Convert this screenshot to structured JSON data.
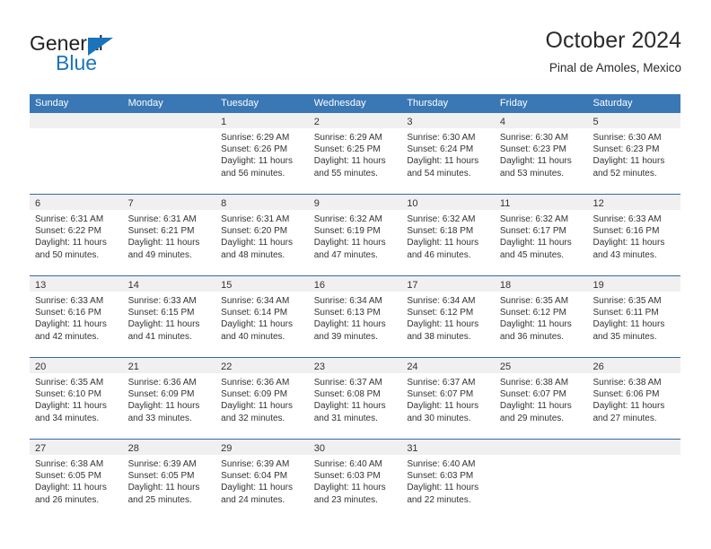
{
  "brand": {
    "word1": "General",
    "word2": "Blue",
    "triangle_color": "#1a74bb",
    "text_color": "#231f20"
  },
  "header": {
    "title": "October 2024",
    "subtitle": "Pinal de Amoles, Mexico",
    "accent_color": "#3a77b5"
  },
  "calendar": {
    "weekdays": [
      "Sunday",
      "Monday",
      "Tuesday",
      "Wednesday",
      "Thursday",
      "Friday",
      "Saturday"
    ],
    "labels": {
      "sunrise": "Sunrise:",
      "sunset": "Sunset:",
      "daylight": "Daylight:"
    },
    "weeks": [
      [
        {
          "day": "",
          "sunrise": "",
          "sunset": "",
          "daylight_1": "",
          "daylight_2": ""
        },
        {
          "day": "",
          "sunrise": "",
          "sunset": "",
          "daylight_1": "",
          "daylight_2": ""
        },
        {
          "day": "1",
          "sunrise": "Sunrise: 6:29 AM",
          "sunset": "Sunset: 6:26 PM",
          "daylight_1": "Daylight: 11 hours",
          "daylight_2": "and 56 minutes."
        },
        {
          "day": "2",
          "sunrise": "Sunrise: 6:29 AM",
          "sunset": "Sunset: 6:25 PM",
          "daylight_1": "Daylight: 11 hours",
          "daylight_2": "and 55 minutes."
        },
        {
          "day": "3",
          "sunrise": "Sunrise: 6:30 AM",
          "sunset": "Sunset: 6:24 PM",
          "daylight_1": "Daylight: 11 hours",
          "daylight_2": "and 54 minutes."
        },
        {
          "day": "4",
          "sunrise": "Sunrise: 6:30 AM",
          "sunset": "Sunset: 6:23 PM",
          "daylight_1": "Daylight: 11 hours",
          "daylight_2": "and 53 minutes."
        },
        {
          "day": "5",
          "sunrise": "Sunrise: 6:30 AM",
          "sunset": "Sunset: 6:23 PM",
          "daylight_1": "Daylight: 11 hours",
          "daylight_2": "and 52 minutes."
        }
      ],
      [
        {
          "day": "6",
          "sunrise": "Sunrise: 6:31 AM",
          "sunset": "Sunset: 6:22 PM",
          "daylight_1": "Daylight: 11 hours",
          "daylight_2": "and 50 minutes."
        },
        {
          "day": "7",
          "sunrise": "Sunrise: 6:31 AM",
          "sunset": "Sunset: 6:21 PM",
          "daylight_1": "Daylight: 11 hours",
          "daylight_2": "and 49 minutes."
        },
        {
          "day": "8",
          "sunrise": "Sunrise: 6:31 AM",
          "sunset": "Sunset: 6:20 PM",
          "daylight_1": "Daylight: 11 hours",
          "daylight_2": "and 48 minutes."
        },
        {
          "day": "9",
          "sunrise": "Sunrise: 6:32 AM",
          "sunset": "Sunset: 6:19 PM",
          "daylight_1": "Daylight: 11 hours",
          "daylight_2": "and 47 minutes."
        },
        {
          "day": "10",
          "sunrise": "Sunrise: 6:32 AM",
          "sunset": "Sunset: 6:18 PM",
          "daylight_1": "Daylight: 11 hours",
          "daylight_2": "and 46 minutes."
        },
        {
          "day": "11",
          "sunrise": "Sunrise: 6:32 AM",
          "sunset": "Sunset: 6:17 PM",
          "daylight_1": "Daylight: 11 hours",
          "daylight_2": "and 45 minutes."
        },
        {
          "day": "12",
          "sunrise": "Sunrise: 6:33 AM",
          "sunset": "Sunset: 6:16 PM",
          "daylight_1": "Daylight: 11 hours",
          "daylight_2": "and 43 minutes."
        }
      ],
      [
        {
          "day": "13",
          "sunrise": "Sunrise: 6:33 AM",
          "sunset": "Sunset: 6:16 PM",
          "daylight_1": "Daylight: 11 hours",
          "daylight_2": "and 42 minutes."
        },
        {
          "day": "14",
          "sunrise": "Sunrise: 6:33 AM",
          "sunset": "Sunset: 6:15 PM",
          "daylight_1": "Daylight: 11 hours",
          "daylight_2": "and 41 minutes."
        },
        {
          "day": "15",
          "sunrise": "Sunrise: 6:34 AM",
          "sunset": "Sunset: 6:14 PM",
          "daylight_1": "Daylight: 11 hours",
          "daylight_2": "and 40 minutes."
        },
        {
          "day": "16",
          "sunrise": "Sunrise: 6:34 AM",
          "sunset": "Sunset: 6:13 PM",
          "daylight_1": "Daylight: 11 hours",
          "daylight_2": "and 39 minutes."
        },
        {
          "day": "17",
          "sunrise": "Sunrise: 6:34 AM",
          "sunset": "Sunset: 6:12 PM",
          "daylight_1": "Daylight: 11 hours",
          "daylight_2": "and 38 minutes."
        },
        {
          "day": "18",
          "sunrise": "Sunrise: 6:35 AM",
          "sunset": "Sunset: 6:12 PM",
          "daylight_1": "Daylight: 11 hours",
          "daylight_2": "and 36 minutes."
        },
        {
          "day": "19",
          "sunrise": "Sunrise: 6:35 AM",
          "sunset": "Sunset: 6:11 PM",
          "daylight_1": "Daylight: 11 hours",
          "daylight_2": "and 35 minutes."
        }
      ],
      [
        {
          "day": "20",
          "sunrise": "Sunrise: 6:35 AM",
          "sunset": "Sunset: 6:10 PM",
          "daylight_1": "Daylight: 11 hours",
          "daylight_2": "and 34 minutes."
        },
        {
          "day": "21",
          "sunrise": "Sunrise: 6:36 AM",
          "sunset": "Sunset: 6:09 PM",
          "daylight_1": "Daylight: 11 hours",
          "daylight_2": "and 33 minutes."
        },
        {
          "day": "22",
          "sunrise": "Sunrise: 6:36 AM",
          "sunset": "Sunset: 6:09 PM",
          "daylight_1": "Daylight: 11 hours",
          "daylight_2": "and 32 minutes."
        },
        {
          "day": "23",
          "sunrise": "Sunrise: 6:37 AM",
          "sunset": "Sunset: 6:08 PM",
          "daylight_1": "Daylight: 11 hours",
          "daylight_2": "and 31 minutes."
        },
        {
          "day": "24",
          "sunrise": "Sunrise: 6:37 AM",
          "sunset": "Sunset: 6:07 PM",
          "daylight_1": "Daylight: 11 hours",
          "daylight_2": "and 30 minutes."
        },
        {
          "day": "25",
          "sunrise": "Sunrise: 6:38 AM",
          "sunset": "Sunset: 6:07 PM",
          "daylight_1": "Daylight: 11 hours",
          "daylight_2": "and 29 minutes."
        },
        {
          "day": "26",
          "sunrise": "Sunrise: 6:38 AM",
          "sunset": "Sunset: 6:06 PM",
          "daylight_1": "Daylight: 11 hours",
          "daylight_2": "and 27 minutes."
        }
      ],
      [
        {
          "day": "27",
          "sunrise": "Sunrise: 6:38 AM",
          "sunset": "Sunset: 6:05 PM",
          "daylight_1": "Daylight: 11 hours",
          "daylight_2": "and 26 minutes."
        },
        {
          "day": "28",
          "sunrise": "Sunrise: 6:39 AM",
          "sunset": "Sunset: 6:05 PM",
          "daylight_1": "Daylight: 11 hours",
          "daylight_2": "and 25 minutes."
        },
        {
          "day": "29",
          "sunrise": "Sunrise: 6:39 AM",
          "sunset": "Sunset: 6:04 PM",
          "daylight_1": "Daylight: 11 hours",
          "daylight_2": "and 24 minutes."
        },
        {
          "day": "30",
          "sunrise": "Sunrise: 6:40 AM",
          "sunset": "Sunset: 6:03 PM",
          "daylight_1": "Daylight: 11 hours",
          "daylight_2": "and 23 minutes."
        },
        {
          "day": "31",
          "sunrise": "Sunrise: 6:40 AM",
          "sunset": "Sunset: 6:03 PM",
          "daylight_1": "Daylight: 11 hours",
          "daylight_2": "and 22 minutes."
        },
        {
          "day": "",
          "sunrise": "",
          "sunset": "",
          "daylight_1": "",
          "daylight_2": ""
        },
        {
          "day": "",
          "sunrise": "",
          "sunset": "",
          "daylight_1": "",
          "daylight_2": ""
        }
      ]
    ]
  }
}
